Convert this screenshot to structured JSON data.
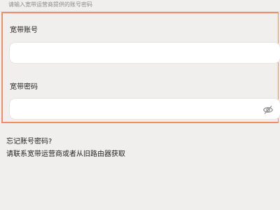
{
  "hint": "请输入宽带运营商提供的账号密码",
  "account": {
    "label": "宽带账号",
    "value": "",
    "placeholder": ""
  },
  "password": {
    "label": "宽带密码",
    "value": "",
    "placeholder": "",
    "toggle_icon": "eye-icon"
  },
  "forgot": {
    "title": "忘记账号密码?",
    "description": "请联系宽带运营商或者从旧路由器获取"
  },
  "colors": {
    "background": "#f1efee",
    "accent_border": "#f08e63",
    "input_background": "#ffffff"
  }
}
